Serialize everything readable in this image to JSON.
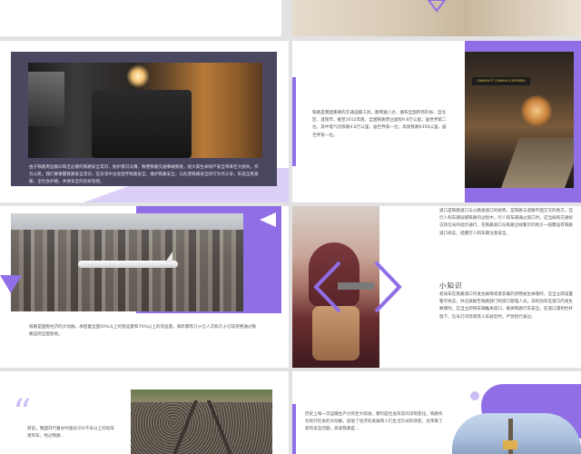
{
  "colors": {
    "accent": "#8f6ee6",
    "accent_light": "#cdbdf5",
    "dark_panel": "#4a4760",
    "background": "#e2e2e4",
    "text": "#555555"
  },
  "slides": {
    "s2": {
      "body": "由于铁路周边群众缺乏必要的铁路安全常识，防护意识淡薄，致使铁路交通事故频发，给大家生命财产安全带来巨大损失。作为公民，我们要掌握铁路安全常识，在日常中主动宣传铁路安全，维护铁路安全，与危害铁路安全的行为作斗争，形成全民爱路、全社会护路，共保安全的良好氛围。"
    },
    "s3": {
      "body": "铁路是我国重要的交通运输工具，路网遍八达，遍布全国所有的省、自治区、直辖市。截至2012年底，全国铁路营业里程9.8万公里，居世界第二位，其中电气化铁路4.8万公里，居世界第一位；高速铁路9356公里，居世界第一位。",
      "sign_text": "CANNON ST  CHARING X  MORDEN"
    },
    "s4": {
      "body": "铁路是国民经济的大动脉，承担着全国50%以上的客运量和70%以上的货运量。每年都有几十亿人次和几十亿吨货物通过铁路运到全国各地。"
    },
    "s5": {
      "top_text": "道口是铁路道口与公路类道口的统称，是铁路与道路平面交叉的地方。在行人和车辆穿越铁路的过程中，行人和车辆通过道口时，应当按照交通标志和信号的指示通行，在铁路道口与铁路沿线警示的地方一般都设有铁路道口标志，提醒行人和车辆注意安全。",
      "heading": "小知识",
      "bottom_text": "机动车在铁路道口内发生故障或者装载的货物发生掉落时，应当立即设置警示标志，并迅速报告铁路部门和道口管理人员。非机动车在道口内发生故障时，应当立即将车辆推离道口，确保铁路行车安全。在道口遇到栏杆放下、信号灯闪烁或有火车驶近时，严禁抢行通过。"
    },
    "s6": {
      "quote_mark": "“",
      "body": "目前，我国开行着办时速达350千米以上的动车组列车，经过铁路..."
    },
    "s7": {
      "body": "历史上每一次运输生产力的巨大跃进，都引起社会形态的深刻变化。铁路作为现代社会的大动脉，促进了经济的发展和人们生活方式的改变，也带来了新的安全问题。高速铁路是..."
    }
  }
}
